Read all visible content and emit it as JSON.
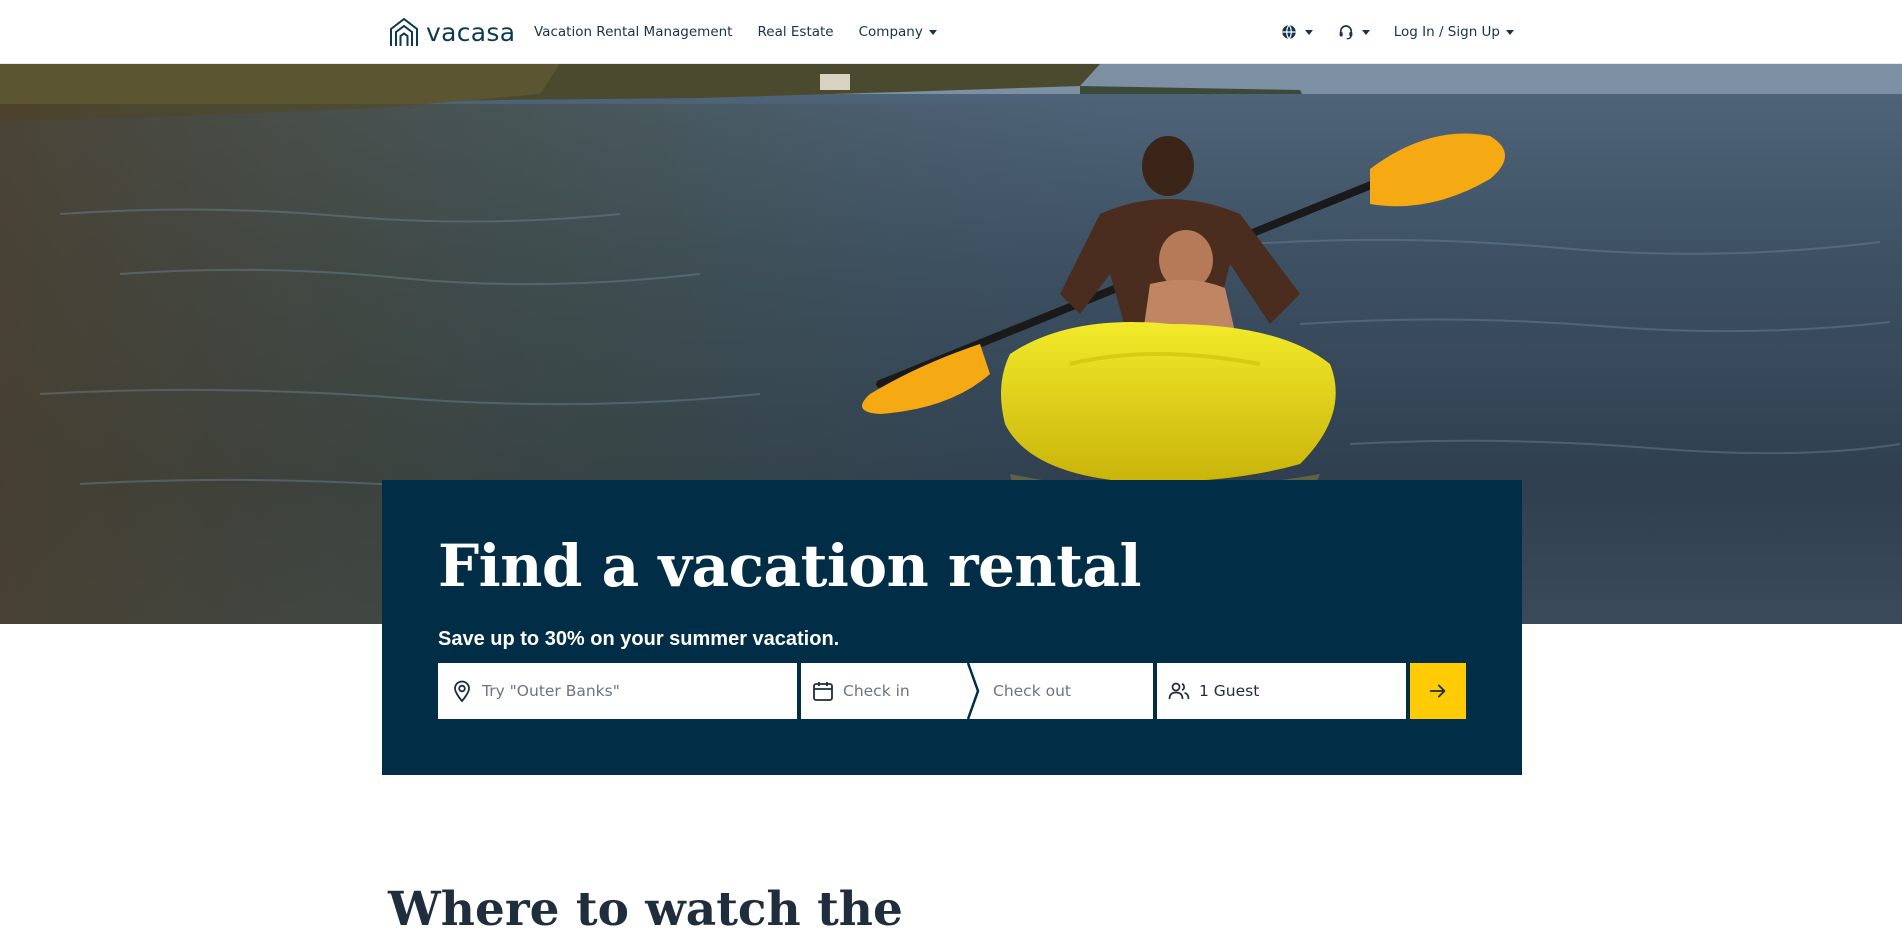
{
  "header": {
    "logo_text": "vacasa",
    "nav": [
      {
        "label": "Vacation Rental Management"
      },
      {
        "label": "Real Estate"
      },
      {
        "label": "Company"
      }
    ],
    "icons": {
      "language": "globe-icon",
      "support": "headset-icon"
    },
    "login_label": "Log In / Sign Up"
  },
  "hero": {
    "title": "Find a vacation rental",
    "subtitle": "Save up to 30% on your summer vacation."
  },
  "search": {
    "where_placeholder": "Try \"Outer Banks\"",
    "checkin_placeholder": "Check in",
    "checkout_placeholder": "Check out",
    "guests_value": "1 Guest",
    "submit_icon": "arrow-right-icon"
  },
  "section": {
    "title": "Where to watch the"
  },
  "colors": {
    "brand_navy": "#012e46",
    "accent_yellow": "#ffcb05",
    "nav_text": "#15354a"
  }
}
